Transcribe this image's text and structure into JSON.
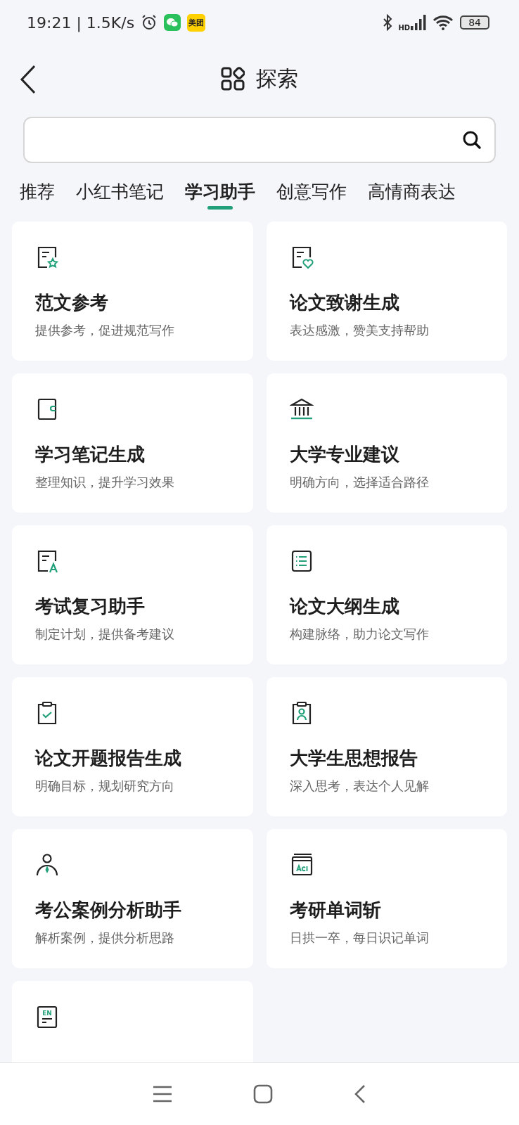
{
  "status_bar": {
    "time_speed": "19:21 | 1.5K/s",
    "meituan_badge": "美团",
    "network": "HD",
    "battery": "84"
  },
  "header": {
    "title": "探索"
  },
  "tabs": [
    {
      "label": "推荐",
      "selected": false
    },
    {
      "label": "小红书笔记",
      "selected": false
    },
    {
      "label": "学习助手",
      "selected": true
    },
    {
      "label": "创意写作",
      "selected": false
    },
    {
      "label": "高情商表达",
      "selected": false
    }
  ],
  "cards": [
    {
      "kind": "star-doc",
      "title": "范文参考",
      "subtitle": "提供参考，促进规范写作"
    },
    {
      "kind": "heart-doc",
      "title": "论文致谢生成",
      "subtitle": "表达感激，赞美支持帮助"
    },
    {
      "kind": "notebook",
      "title": "学习笔记生成",
      "subtitle": "整理知识，提升学习效果"
    },
    {
      "kind": "building",
      "title": "大学专业建议",
      "subtitle": "明确方向，选择适合路径"
    },
    {
      "kind": "letter-doc",
      "title": "考试复习助手",
      "subtitle": "制定计划，提供备考建议"
    },
    {
      "kind": "list",
      "title": "论文大纲生成",
      "subtitle": "构建脉络，助力论文写作"
    },
    {
      "kind": "clipboard-check",
      "title": "论文开题报告生成",
      "subtitle": "明确目标，规划研究方向"
    },
    {
      "kind": "clipboard-person",
      "title": "大学生思想报告",
      "subtitle": "深入思考，表达个人见解"
    },
    {
      "kind": "person-tie",
      "title": "考公案例分析助手",
      "subtitle": "解析案例，提供分析思路"
    },
    {
      "kind": "book-aa",
      "title": "考研单词斩",
      "subtitle": "日拱一卒，每日识记单词"
    },
    {
      "kind": "en-doc",
      "badge": "EN"
    }
  ]
}
